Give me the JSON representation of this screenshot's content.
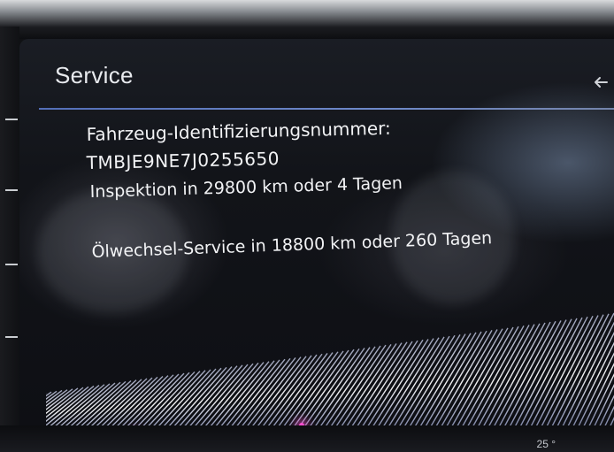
{
  "header": {
    "title": "Service",
    "back_icon": "back-arrow-icon"
  },
  "content": {
    "vin_label": "Fahrzeug-Identifizierungsnummer:",
    "vin_value": "TMBJE9NE7J0255650",
    "inspection_text": "Inspektion in 29800 km oder 4 Tagen",
    "oil_service_text": "Ölwechsel-Service in 18800 km oder 260 Tagen"
  },
  "bottom": {
    "partial_text": "25 °"
  },
  "colors": {
    "accent_line": "#5a78c8",
    "text": "#f2f3f5",
    "background": "#0e0f14",
    "ambient_light": "#ff4fd0"
  }
}
